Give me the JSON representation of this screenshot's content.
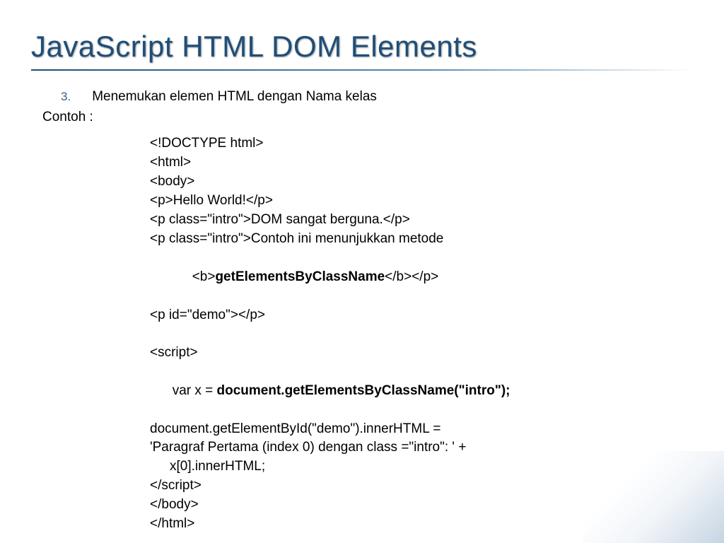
{
  "title": "JavaScript HTML DOM Elements",
  "list": {
    "number": "3.",
    "heading": "Menemukan elemen HTML dengan Nama kelas",
    "contoh": "Contoh :"
  },
  "code": {
    "l1": "<!DOCTYPE html>",
    "l2": "<html>",
    "l3": "<body>",
    "l4": "<p>Hello World!</p>",
    "l5": "<p class=\"intro\">DOM sangat berguna.</p>",
    "l6": "<p class=\"intro\">Contoh ini menunjukkan metode",
    "l6b_pre": "<b>",
    "l6b_bold": "getElementsByClassName",
    "l6b_post": "</b></p>",
    "l7": "<p id=\"demo\"></p>",
    "l8": "<script>",
    "l9_pre": "var x = ",
    "l9_bold": "document.getElementsByClassName(\"intro\");",
    "l10": "document.getElementById(\"demo\").innerHTML =",
    "l11": "'Paragraf Pertama (index 0) dengan class =\"intro\": ' +",
    "l11b": "x[0].innerHTML;",
    "l12": "</script>",
    "l13": "</body>",
    "l14": "</html>"
  }
}
